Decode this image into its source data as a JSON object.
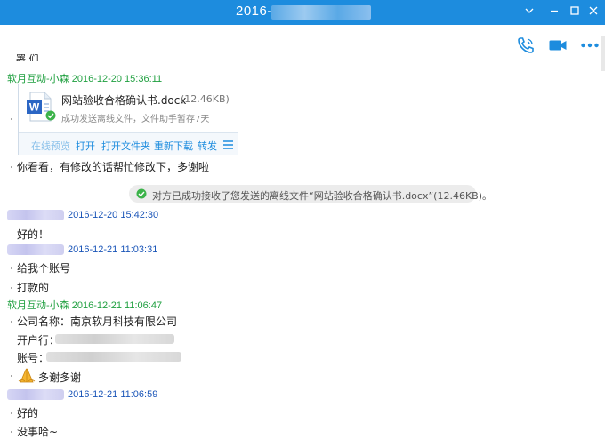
{
  "window": {
    "title": "2016-"
  },
  "toolbar": {
    "icons": [
      "phone-icon",
      "video-icon",
      "more-icon"
    ]
  },
  "top_partial": "署 们",
  "file_card": {
    "name": "网站验收合格确认书.docx",
    "size": "(12.46KB)",
    "status": "成功发送离线文件，文件助手暂存7天",
    "actions": {
      "preview": "在线预览",
      "open": "打开",
      "open_folder": "打开文件夹",
      "redownload": "重新下载",
      "forward": "转发"
    }
  },
  "system_notice": "对方已成功接收了您发送的离线文件“网站验收合格确认书.docx”(12.46KB)。",
  "messages": [
    {
      "sender": "软月互动-小森",
      "time": "2016-12-20 15:36:11"
    },
    {
      "text": "你看看，有修改的话帮忙修改下，多谢啦"
    },
    {
      "time": "2016-12-20 15:42:30",
      "text": "好的！"
    },
    {
      "time": "2016-12-21 11:03:31",
      "lines": [
        "给我个账号",
        "打款的"
      ]
    },
    {
      "sender": "软月互动-小森",
      "time": "2016-12-21 11:06:47",
      "lines": [
        "公司名称：南京软月科技有限公司",
        "开户行：",
        "账号："
      ],
      "thanks": "多谢多谢"
    },
    {
      "time": "2016-12-21 11:06:59",
      "lines": [
        "好的",
        "没事哈~"
      ]
    }
  ],
  "colors": {
    "titlebar": "#1d8cde",
    "sender_green": "#20a040",
    "sender_blue": "#1a55b8",
    "link": "#1d8cde"
  }
}
